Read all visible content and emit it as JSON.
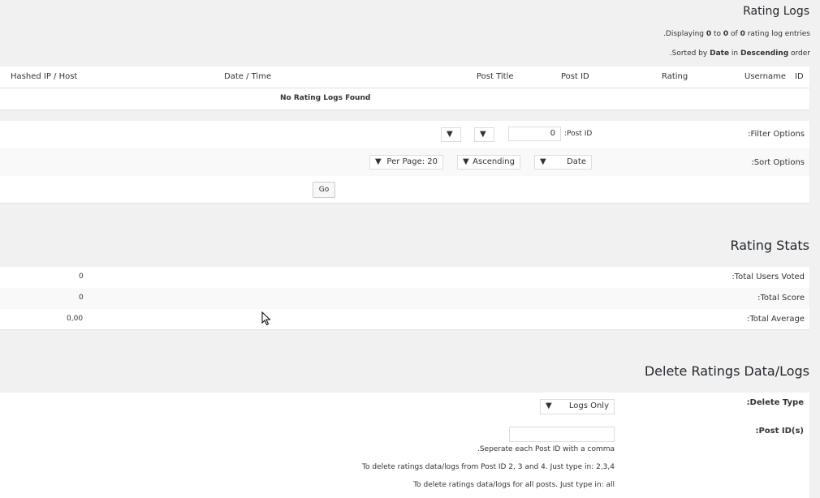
{
  "logs": {
    "title": "Rating Logs",
    "displaying": {
      "pre": ".Displaying ",
      "a": "0",
      "to": " to ",
      "b": "0",
      "of": " of ",
      "c": "0",
      "post": " rating log entries"
    },
    "sorted": {
      "pre": ".Sorted by ",
      "field": "Date",
      "in": " in ",
      "order": "Descending",
      "post": " order"
    },
    "columns": [
      "Hashed IP / Host",
      "Date / Time",
      "Post Title",
      "Post ID",
      "Rating",
      "Username",
      "ID"
    ],
    "empty": "No Rating Logs Found"
  },
  "filter": {
    "label": ":Filter Options",
    "post_id_label": ":Post ID",
    "post_id_value": "0",
    "select1": "",
    "select2": ""
  },
  "sort": {
    "label": ":Sort Options",
    "by": "Date",
    "order": "Ascending",
    "per_page": "Per Page: 20",
    "go": "Go"
  },
  "stats": {
    "title": "Rating Stats",
    "rows": [
      {
        "label": ":Total Users Voted",
        "value": "0"
      },
      {
        "label": ":Total Score",
        "value": "0"
      },
      {
        "label": ":Total Average",
        "value": "0,00"
      }
    ]
  },
  "delete": {
    "title": "Delete Ratings Data/Logs",
    "type_label": ":Delete Type",
    "type_value": "Logs Only",
    "ids_label": ":Post ID(s)",
    "ids_value": "",
    "help1": ".Seperate each Post ID with a comma",
    "help2": "To delete ratings data/logs from Post ID 2, 3 and 4. Just type in: 2,3,4",
    "help3": "To delete ratings data/logs for all posts. Just type in: all"
  },
  "icons": {
    "dropdown": "triangle-down",
    "cursor": "mouse-pointer"
  }
}
